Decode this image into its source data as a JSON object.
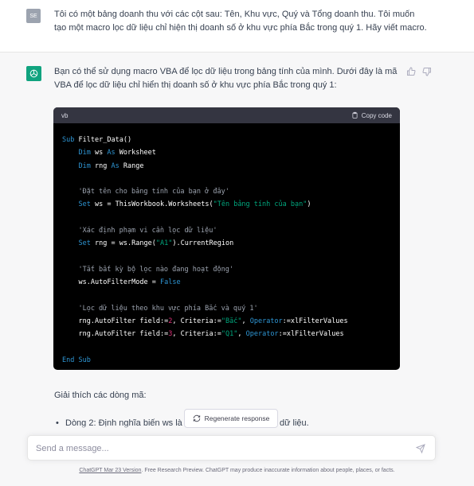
{
  "user_message": {
    "avatar_initials": "SE",
    "text": "Tôi có một bảng doanh thu với các cột sau: Tên, Khu vực, Quý và Tổng doanh thu. Tôi muốn tạo một macro lọc dữ liệu chỉ hiện thị doanh số ở khu vực phía Bắc trong quý 1.  Hãy viết macro."
  },
  "assistant_message": {
    "intro": "Bạn có thể sử dụng macro VBA để lọc dữ liệu trong bảng tính của mình. Dưới đây là mã VBA để lọc dữ liệu chỉ hiển thị doanh số ở khu vực phía Bắc trong quý 1:",
    "code_language": "vb",
    "copy_label": "Copy code",
    "code_lines": [
      "Sub Filter_Data()",
      "    Dim ws As Worksheet",
      "    Dim rng As Range",
      "",
      "    'Đặt tên cho bảng tính của bạn ở đây'",
      "    Set ws = ThisWorkbook.Worksheets(\"Tên bảng tính của bạn\")",
      "",
      "    'Xác định phạm vi cần lọc dữ liệu'",
      "    Set rng = ws.Range(\"A1\").CurrentRegion",
      "",
      "    'Tắt bất kỳ bộ lọc nào đang hoạt động'",
      "    ws.AutoFilterMode = False",
      "",
      "    'Lọc dữ liệu theo khu vực phía Bắc và quý 1'",
      "    rng.AutoFilter field:=2, Criteria1:=\"Bắc\", Operator:=xlFilterValues",
      "    rng.AutoFilter field:=3, Criteria1:=\"Q1\", Operator:=xlFilterValues",
      "",
      "End Sub"
    ],
    "explain_heading": "Giải thích các dòng mã:",
    "bullet_1_start": "Dòng 2: Định nghĩa biến ws là bả",
    "bullet_1_end": "dữ liệu."
  },
  "regenerate_label": "Regenerate response",
  "input": {
    "placeholder": "Send a message..."
  },
  "footer": {
    "version_link": "ChatGPT Mar 23 Version",
    "disclaimer": ". Free Research Preview. ChatGPT may produce inaccurate information about people, places, or facts."
  },
  "colors": {
    "brand": "#10a37f",
    "code_bg": "#000000",
    "code_header": "#343541"
  }
}
